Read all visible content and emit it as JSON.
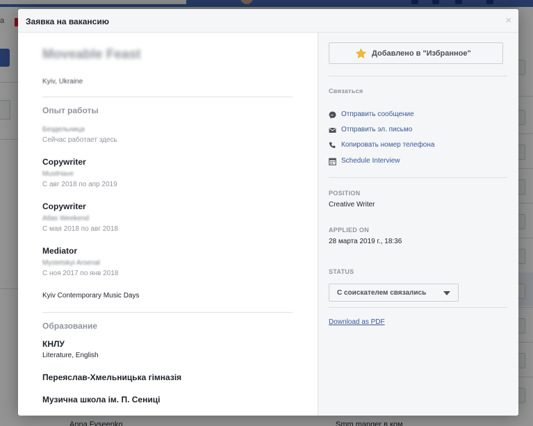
{
  "modal": {
    "title": "Заявка на вакансию",
    "close": "×"
  },
  "candidate": {
    "name": "Moveable Feast",
    "location": "Kyiv, Ukraine"
  },
  "experience": {
    "heading": "Опыт работы",
    "items": [
      {
        "title": "",
        "company": "Бездельница",
        "dates": "Сейчас работает здесь"
      },
      {
        "title": "Copywriter",
        "company": "MustHave",
        "dates": "С авг 2018 по апр 2019"
      },
      {
        "title": "Copywriter",
        "company": "Atlas Weekend",
        "dates": "С мая 2018 по авг 2018"
      },
      {
        "title": "Mediator",
        "company": "Mystetskyi Arsenal",
        "dates": "С ноя 2017 по янв 2018"
      }
    ],
    "extra": "Kyiv Contemporary Music Days"
  },
  "education": {
    "heading": "Образование",
    "items": [
      {
        "title": "КНЛУ",
        "subtitle": "Literature, English"
      },
      {
        "title": "Переяслав-Хмельницька гімназія"
      },
      {
        "title": "Музична школа ім. П. Сениці"
      }
    ]
  },
  "sidebar": {
    "favorite_label": "Добавлено в \"Избранное\"",
    "contact_heading": "Связаться",
    "contacts": [
      {
        "label": "Отправить сообщение",
        "icon": "messenger-icon"
      },
      {
        "label": "Отправить эл. письмо",
        "icon": "envelope-icon"
      },
      {
        "label": "Копировать номер телефона",
        "icon": "phone-icon"
      },
      {
        "label": "Schedule Interview",
        "icon": "calendar-icon"
      }
    ],
    "position_heading": "POSITION",
    "position_value": "Creative Writer",
    "applied_heading": "APPLIED ON",
    "applied_value": "28 марта 2019 г., 18:36",
    "status_heading": "STATUS",
    "status_value": "С соискателем связались",
    "pdf_label": "Download as PDF"
  },
  "background": {
    "left_text": "а",
    "bottom_name": "Anna Fyseenko",
    "bottom_role": "Smm manger в ком"
  },
  "colors": {
    "link": "#365899",
    "star": "#f7b928",
    "overlay": "rgba(0,0,0,0.42)"
  }
}
